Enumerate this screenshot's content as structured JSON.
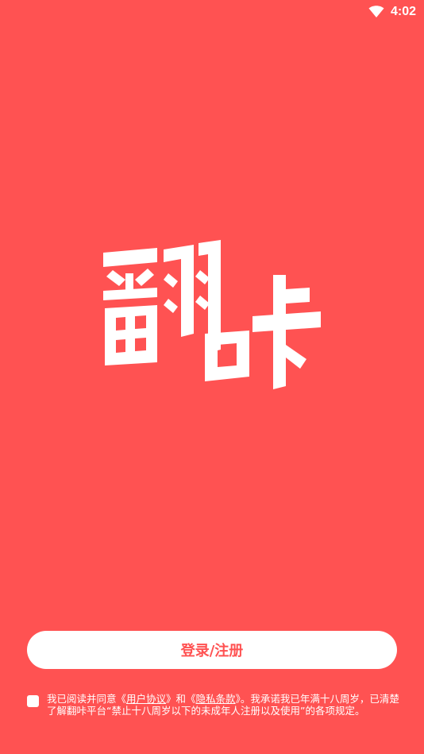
{
  "status_bar": {
    "time": "4:02",
    "icons": [
      "wifi-icon"
    ]
  },
  "app": {
    "logo_text": "翻咔",
    "background_color": "#FF5252",
    "accent_color": "#FF5252"
  },
  "login": {
    "button_label": "登录/注册"
  },
  "agreement": {
    "checked": false,
    "prefix": "我已阅读并同意《",
    "user_agreement": "用户协议",
    "middle1": "》和《",
    "privacy_policy": "隐私条款",
    "suffix": "》。我承诺我已年满十八周岁，已清楚了解翻咔平台“禁止十八周岁以下的未成年人注册以及使用”的各项规定。"
  }
}
